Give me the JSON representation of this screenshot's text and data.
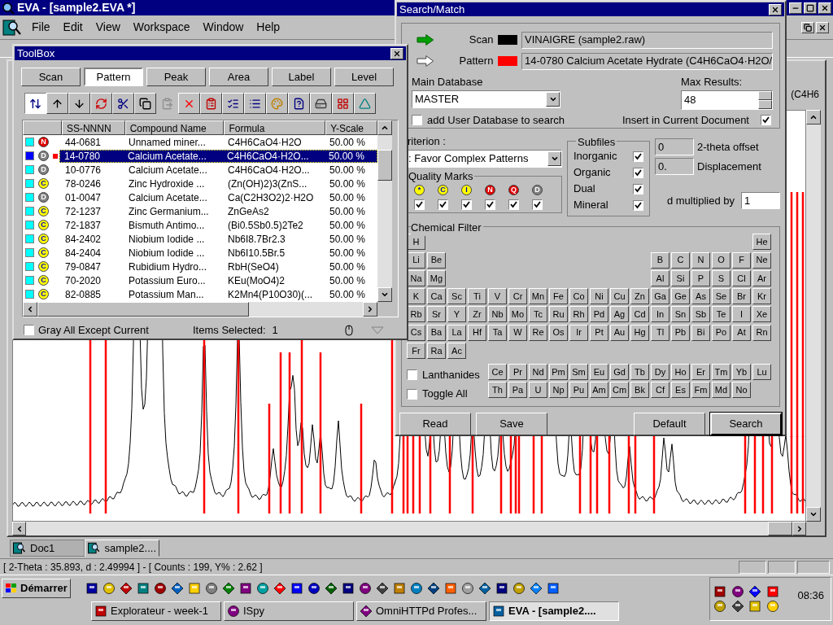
{
  "main_window": {
    "title": "EVA - [sample2.EVA *]",
    "menu": [
      "File",
      "Edit",
      "View",
      "Workspace",
      "Window",
      "Help"
    ]
  },
  "document": {
    "legend_fragment": "(C4H6",
    "tabs": [
      {
        "label": "Doc1",
        "selected": false
      },
      {
        "label": "sample2....",
        "selected": true
      }
    ]
  },
  "status_bar": {
    "text": "[ 2-Theta : 35.893, d : 2.49994 ] - [ Counts : 199, Y% : 2.62 ]"
  },
  "toolbox": {
    "title": "ToolBox",
    "tabs": [
      {
        "label": "Scan",
        "selected": false
      },
      {
        "label": "Pattern",
        "selected": true
      },
      {
        "label": "Peak",
        "selected": false
      },
      {
        "label": "Area",
        "selected": false
      },
      {
        "label": "Label",
        "selected": false
      },
      {
        "label": "Level",
        "selected": false
      }
    ],
    "tools": [
      {
        "kind": "sort",
        "selected": true,
        "disabled": false
      },
      {
        "kind": "up",
        "selected": false,
        "disabled": false
      },
      {
        "kind": "down",
        "selected": false,
        "disabled": false
      },
      {
        "kind": "refresh",
        "selected": false,
        "disabled": false
      },
      {
        "kind": "cut",
        "selected": false,
        "disabled": false
      },
      {
        "kind": "copy",
        "selected": false,
        "disabled": false
      },
      {
        "kind": "paste",
        "selected": false,
        "disabled": true
      },
      {
        "kind": "delete",
        "selected": false,
        "disabled": false
      },
      {
        "kind": "undo",
        "selected": false,
        "disabled": false
      },
      {
        "kind": "check",
        "selected": false,
        "disabled": false
      },
      {
        "kind": "uncheck",
        "selected": false,
        "disabled": false
      },
      {
        "kind": "palette",
        "selected": false,
        "disabled": false
      },
      {
        "kind": "query",
        "selected": false,
        "disabled": false
      },
      {
        "kind": "disk",
        "selected": false,
        "disabled": false
      },
      {
        "kind": "chart",
        "selected": false,
        "disabled": false
      },
      {
        "kind": "font",
        "selected": false,
        "disabled": false
      }
    ],
    "columns": [
      "SS-NNNN",
      "Compound Name",
      "Formula",
      "Y-Scale"
    ],
    "rows": [
      {
        "selected": false,
        "badge": {
          "letter": "N",
          "color": "#e00000"
        },
        "code": "44-0681",
        "name": "Unnamed miner...",
        "formula": "C4H6CaO4·H2O",
        "scale": "50.00 %"
      },
      {
        "selected": true,
        "badge": {
          "letter": "D",
          "color": "#808080"
        },
        "code": "14-0780",
        "name": "Calcium Acetate...",
        "formula": "C4H6CaO4·H2O...",
        "scale": "50.00 %"
      },
      {
        "selected": false,
        "badge": {
          "letter": "D",
          "color": "#808080"
        },
        "code": "10-0776",
        "name": "Calcium Acetate...",
        "formula": "C4H6CaO4·H2O...",
        "scale": "50.00 %"
      },
      {
        "selected": false,
        "badge": {
          "letter": "C",
          "color": "#ffff00"
        },
        "code": "78-0246",
        "name": "Zinc Hydroxide ...",
        "formula": "(Zn(OH)2)3(ZnS...",
        "scale": "50.00 %"
      },
      {
        "selected": false,
        "badge": {
          "letter": "D",
          "color": "#808080"
        },
        "code": "01-0047",
        "name": "Calcium Acetate...",
        "formula": "Ca(C2H3O2)2·H2O",
        "scale": "50.00 %"
      },
      {
        "selected": false,
        "badge": {
          "letter": "C",
          "color": "#ffff00"
        },
        "code": "72-1237",
        "name": "Zinc Germanium...",
        "formula": "ZnGeAs2",
        "scale": "50.00 %"
      },
      {
        "selected": false,
        "badge": {
          "letter": "C",
          "color": "#ffff00"
        },
        "code": "72-1837",
        "name": "Bismuth Antimo...",
        "formula": "(Bi0.5Sb0.5)2Te2",
        "scale": "50.00 %"
      },
      {
        "selected": false,
        "badge": {
          "letter": "C",
          "color": "#ffff00"
        },
        "code": "84-2402",
        "name": "Niobium Iodide ...",
        "formula": "Nb6I8.7Br2.3",
        "scale": "50.00 %"
      },
      {
        "selected": false,
        "badge": {
          "letter": "C",
          "color": "#ffff00"
        },
        "code": "84-2404",
        "name": "Niobium Iodide ...",
        "formula": "Nb6I10.5Br.5",
        "scale": "50.00 %"
      },
      {
        "selected": false,
        "badge": {
          "letter": "C",
          "color": "#ffff00"
        },
        "code": "79-0847",
        "name": "Rubidium Hydro...",
        "formula": "RbH(SeO4)",
        "scale": "50.00 %"
      },
      {
        "selected": false,
        "badge": {
          "letter": "C",
          "color": "#ffff00"
        },
        "code": "70-2020",
        "name": "Potassium Euro...",
        "formula": "KEu(MoO4)2",
        "scale": "50.00 %"
      },
      {
        "selected": false,
        "badge": {
          "letter": "C",
          "color": "#ffff00"
        },
        "code": "82-0885",
        "name": "Potassium Man...",
        "formula": "K2Mn4(P10O30)(...",
        "scale": "50.00 %"
      }
    ],
    "gray_all": {
      "label": "Gray All Except Current",
      "checked": false
    },
    "items_selected": {
      "label": "Items Selected:",
      "value": "1"
    }
  },
  "search_match": {
    "title": "Search/Match",
    "scan": {
      "label": "Scan",
      "color": "#000000",
      "value": "VINAIGRE (sample2.raw)"
    },
    "pattern": {
      "label": "Pattern",
      "color": "#ff0000",
      "value": "14-0780 Calcium Acetate Hydrate (C4H6CaO4·H2O/"
    },
    "main_database": {
      "label": "Main Database",
      "value": "MASTER"
    },
    "max_results": {
      "label": "Max Results:",
      "value": "48"
    },
    "add_user_db": {
      "label": "add User Database to search",
      "checked": false
    },
    "insert_current": {
      "label": "Insert in Current Document",
      "checked": true
    },
    "criterion": {
      "label": "riterion :",
      "value": ": Favor Complex Patterns"
    },
    "quality_marks": {
      "label": "Quality Marks",
      "marks": [
        {
          "letter": "*",
          "color": "#ffff00",
          "checked": true
        },
        {
          "letter": "C",
          "color": "#ffff00",
          "checked": true
        },
        {
          "letter": "I",
          "color": "#ffff00",
          "checked": true
        },
        {
          "letter": "N",
          "color": "#e00000",
          "checked": true
        },
        {
          "letter": "Q",
          "color": "#e00000",
          "checked": true
        },
        {
          "letter": "D",
          "color": "#808080",
          "checked": true
        }
      ]
    },
    "subfiles": {
      "label": "Subfiles",
      "items": [
        {
          "label": "Inorganic",
          "checked": true
        },
        {
          "label": "Organic",
          "checked": true
        },
        {
          "label": "Dual",
          "checked": true
        },
        {
          "label": "Mineral",
          "checked": true
        }
      ]
    },
    "two_theta_offset": {
      "label": "2-theta offset",
      "value": "0"
    },
    "displacement": {
      "label": "Displacement",
      "value": "0."
    },
    "d_multiplied": {
      "label": "d multiplied by",
      "value": "1"
    },
    "chemical_filter": {
      "label": "Chemical Filter",
      "rows": [
        {
          "left": [
            "H"
          ],
          "right": [
            "He"
          ]
        },
        {
          "left": [
            "Li",
            "Be"
          ],
          "right": [
            "B",
            "C",
            "N",
            "O",
            "F",
            "Ne"
          ]
        },
        {
          "left": [
            "Na",
            "Mg"
          ],
          "right": [
            "Al",
            "Si",
            "P",
            "S",
            "Cl",
            "Ar"
          ]
        },
        {
          "left": [
            "K",
            "Ca",
            "Sc",
            "Ti",
            "V",
            "Cr",
            "Mn",
            "Fe",
            "Co",
            "Ni",
            "Cu",
            "Zn",
            "Ga",
            "Ge",
            "As",
            "Se",
            "Br",
            "Kr"
          ],
          "right": []
        },
        {
          "left": [
            "Rb",
            "Sr",
            "Y",
            "Zr",
            "Nb",
            "Mo",
            "Tc",
            "Ru",
            "Rh",
            "Pd",
            "Ag",
            "Cd",
            "In",
            "Sn",
            "Sb",
            "Te",
            "I",
            "Xe"
          ],
          "right": []
        },
        {
          "left": [
            "Cs",
            "Ba",
            "La",
            "Hf",
            "Ta",
            "W",
            "Re",
            "Os",
            "Ir",
            "Pt",
            "Au",
            "Hg",
            "Tl",
            "Pb",
            "Bi",
            "Po",
            "At",
            "Rn"
          ],
          "right": []
        },
        {
          "left": [
            "Fr",
            "Ra",
            "Ac"
          ],
          "right": []
        }
      ],
      "f_rows": [
        [
          "Ce",
          "Pr",
          "Nd",
          "Pm",
          "Sm",
          "Eu",
          "Gd",
          "Tb",
          "Dy",
          "Ho",
          "Er",
          "Tm",
          "Yb",
          "Lu"
        ],
        [
          "Th",
          "Pa",
          "U",
          "Np",
          "Pu",
          "Am",
          "Cm",
          "Bk",
          "Cf",
          "Es",
          "Fm",
          "Md",
          "No"
        ]
      ],
      "lanthanides": {
        "label": "Lanthanides",
        "checked": false
      },
      "toggle_all": {
        "label": "Toggle All",
        "checked": false
      }
    },
    "buttons": [
      {
        "label": "Read",
        "default": false
      },
      {
        "label": "Save",
        "default": false
      },
      {
        "label": "Default",
        "default": false
      },
      {
        "label": "Search",
        "default": true
      }
    ]
  },
  "taskbar": {
    "start": "Démarrer",
    "tasks": [
      {
        "label": "Explorateur - week-1",
        "selected": false
      },
      {
        "label": "ISpy",
        "selected": false
      },
      {
        "label": "OmniHTTPd Profes...",
        "selected": false
      },
      {
        "label": "EVA - [sample2....",
        "selected": true
      }
    ],
    "clock": "08:36"
  }
}
